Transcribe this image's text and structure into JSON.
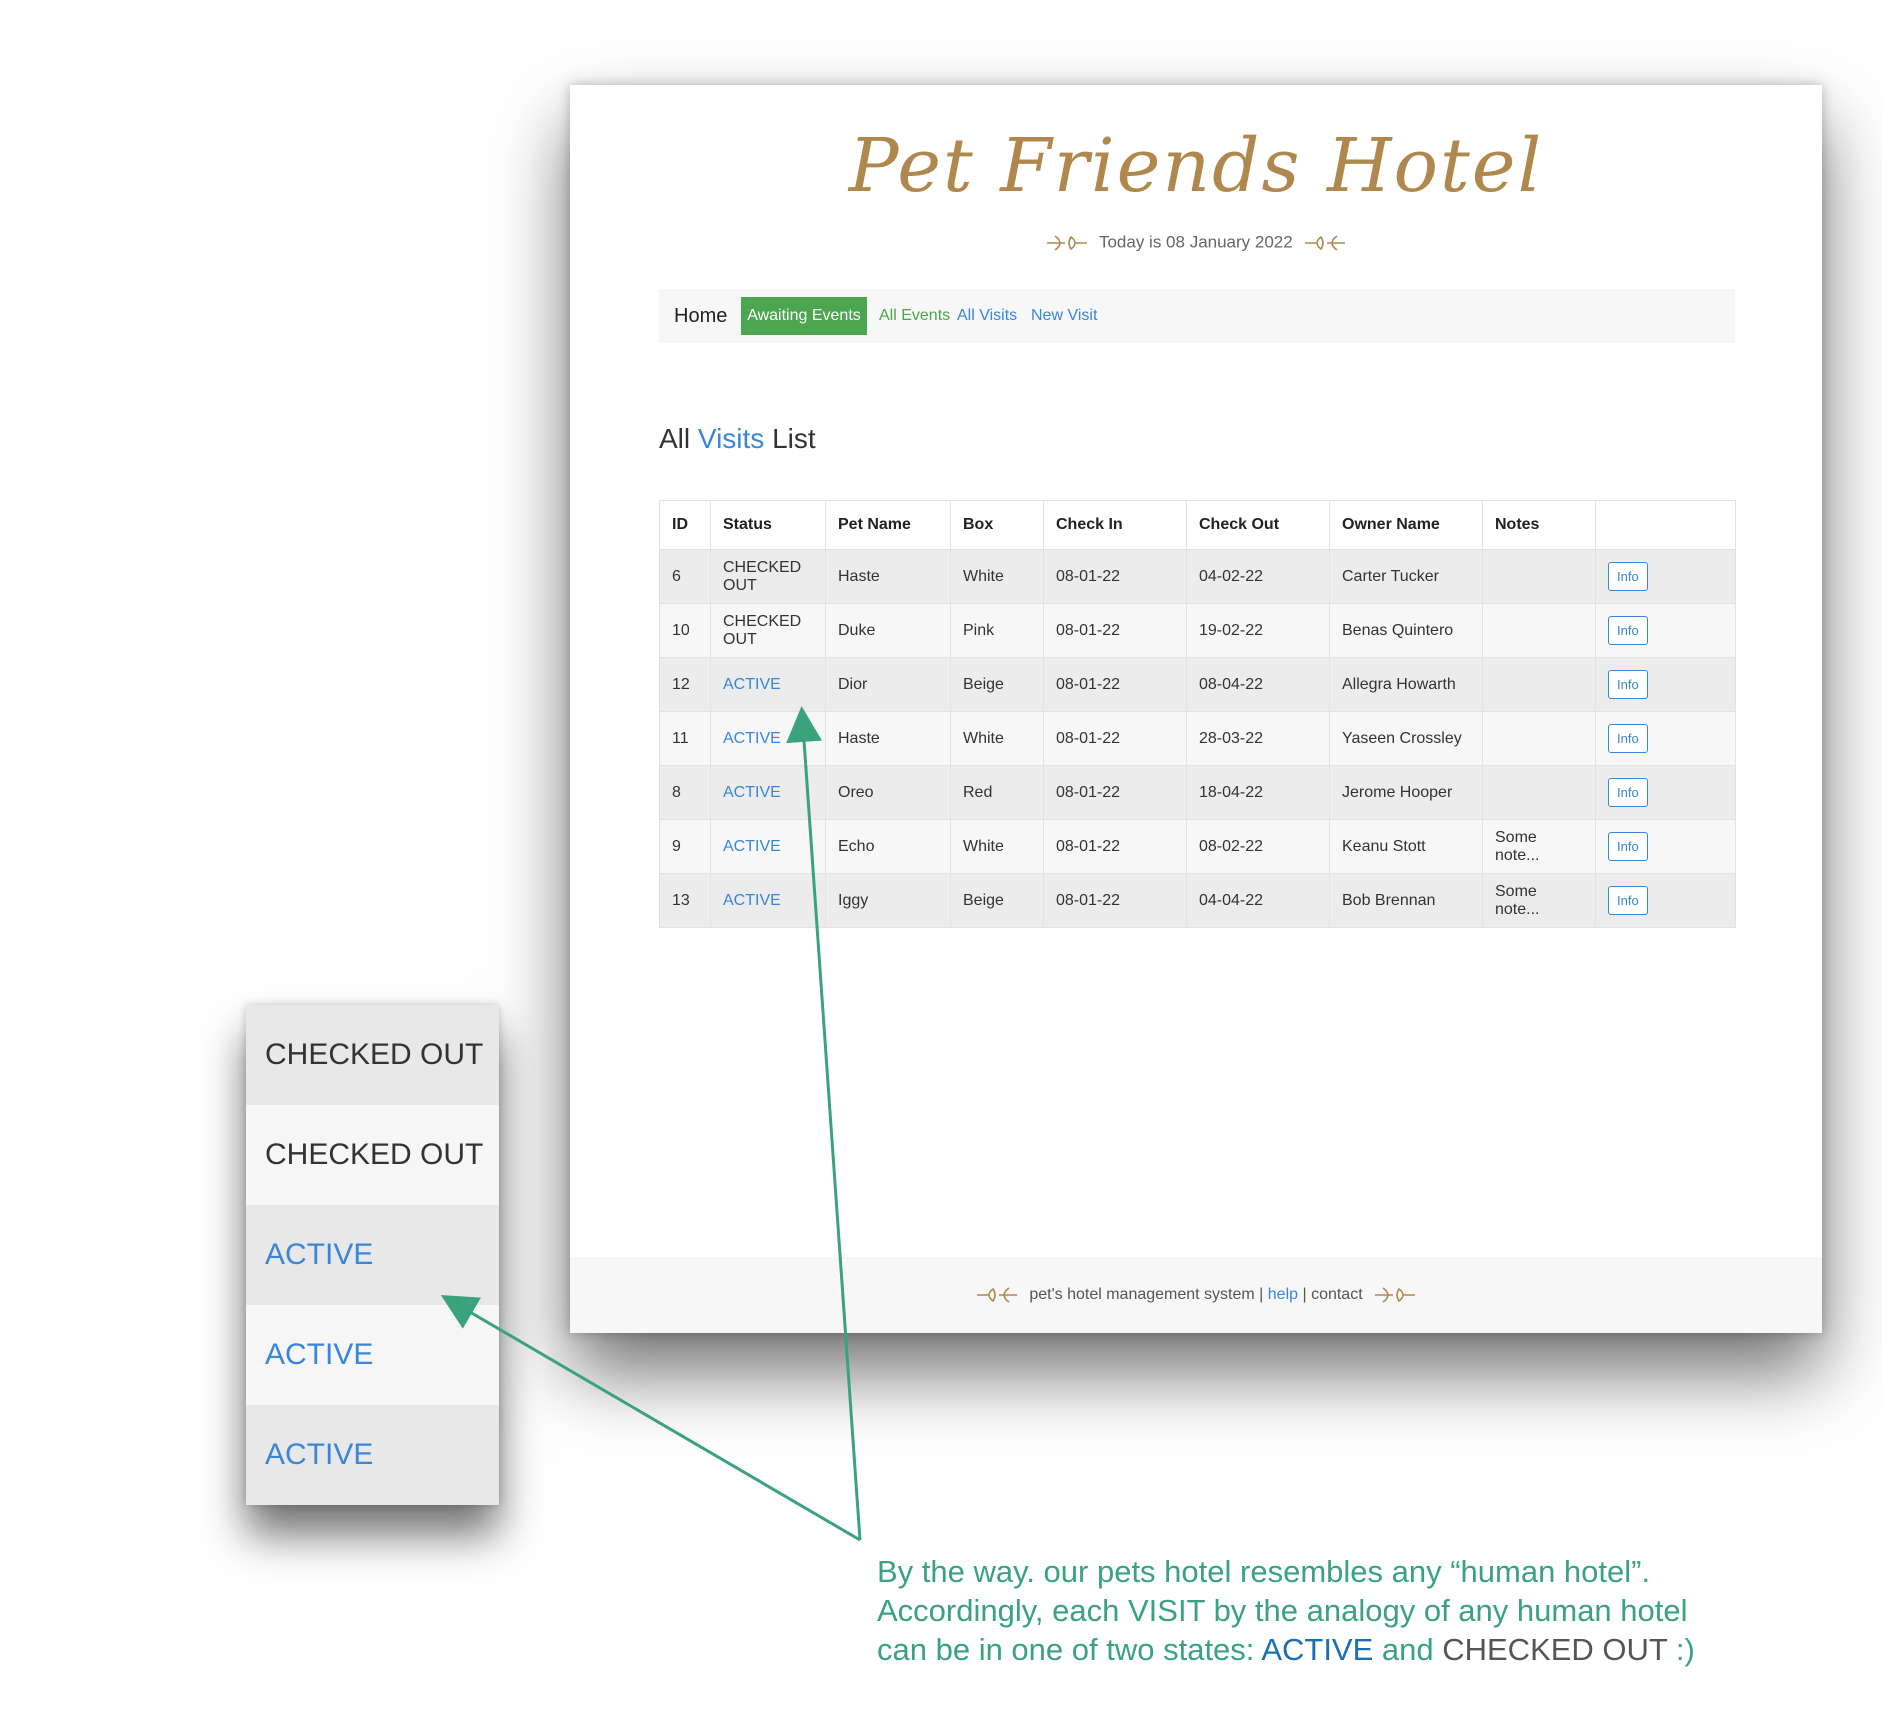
{
  "app": {
    "logo": "Pet Friends Hotel",
    "today_text": "Today is 08 January 2022"
  },
  "nav": {
    "home": "Home",
    "awaiting_events": "Awaiting Events",
    "all_events": "All Events",
    "all_visits": "All Visits",
    "new_visit": "New Visit"
  },
  "page_title": {
    "prefix": "All",
    "highlight": "Visits",
    "suffix": "List"
  },
  "table": {
    "headers": [
      "ID",
      "Status",
      "Pet Name",
      "Box",
      "Check In",
      "Check Out",
      "Owner Name",
      "Notes",
      ""
    ],
    "rows": [
      {
        "id": "6",
        "status": "CHECKED OUT",
        "pet": "Haste",
        "box": "White",
        "check_in": "08-01-22",
        "check_out": "04-02-22",
        "owner": "Carter Tucker",
        "notes": "",
        "action": "Info"
      },
      {
        "id": "10",
        "status": "CHECKED OUT",
        "pet": "Duke",
        "box": "Pink",
        "check_in": "08-01-22",
        "check_out": "19-02-22",
        "owner": "Benas Quintero",
        "notes": "",
        "action": "Info"
      },
      {
        "id": "12",
        "status": "ACTIVE",
        "pet": "Dior",
        "box": "Beige",
        "check_in": "08-01-22",
        "check_out": "08-04-22",
        "owner": "Allegra Howarth",
        "notes": "",
        "action": "Info"
      },
      {
        "id": "11",
        "status": "ACTIVE",
        "pet": "Haste",
        "box": "White",
        "check_in": "08-01-22",
        "check_out": "28-03-22",
        "owner": "Yaseen Crossley",
        "notes": "",
        "action": "Info"
      },
      {
        "id": "8",
        "status": "ACTIVE",
        "pet": "Oreo",
        "box": "Red",
        "check_in": "08-01-22",
        "check_out": "18-04-22",
        "owner": "Jerome Hooper",
        "notes": "",
        "action": "Info"
      },
      {
        "id": "9",
        "status": "ACTIVE",
        "pet": "Echo",
        "box": "White",
        "check_in": "08-01-22",
        "check_out": "08-02-22",
        "owner": "Keanu Stott",
        "notes": "Some note...",
        "action": "Info"
      },
      {
        "id": "13",
        "status": "ACTIVE",
        "pet": "Iggy",
        "box": "Beige",
        "check_in": "08-01-22",
        "check_out": "04-04-22",
        "owner": "Bob Brennan",
        "notes": "Some note...",
        "action": "Info"
      }
    ]
  },
  "footer": {
    "system": "pet's hotel management system",
    "sep1": " | ",
    "help": "help",
    "sep2": " | ",
    "contact": "contact"
  },
  "zoom_statuses": [
    "CHECKED OUT",
    "CHECKED OUT",
    "ACTIVE",
    "ACTIVE",
    "ACTIVE"
  ],
  "annotation": {
    "text_before": "By the way. our pets hotel resembles any “human hotel”. Accordingly, each VISIT by the analogy of any human hotel can be in one of two states: ",
    "active": "ACTIVE",
    "and": " and ",
    "checked_out": "CHECKED OUT",
    "text_after": " :)"
  },
  "colors": {
    "brand_gold": "#b0884e",
    "nav_active_green": "#4ca64f",
    "link_blue": "#3a86d9",
    "annotation_green": "#3aa37e"
  },
  "icons": {
    "flourish_left": "ornament-left-icon",
    "flourish_right": "ornament-right-icon"
  }
}
